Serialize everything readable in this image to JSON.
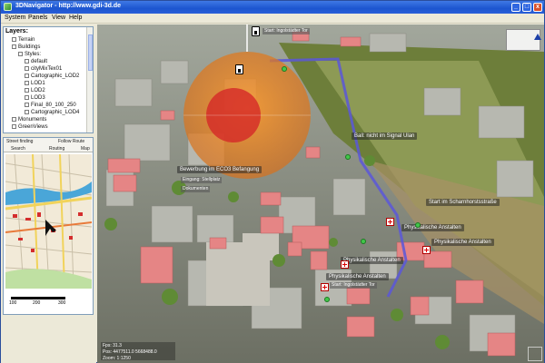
{
  "window": {
    "title": "3DNavigator - http://www.gdi-3d.de",
    "minimize": "_",
    "maximize": "□",
    "close": "x"
  },
  "menu": [
    "System",
    "Panels",
    "View",
    "Help"
  ],
  "layers": {
    "title": "Layers:",
    "items": [
      {
        "label": "Terrain",
        "indent": 1
      },
      {
        "label": "Buildings",
        "indent": 1
      },
      {
        "label": "Styles:",
        "indent": 2
      },
      {
        "label": "default",
        "indent": 3
      },
      {
        "label": "cityMixTex01",
        "indent": 3
      },
      {
        "label": "Cartographic_LOD2",
        "indent": 3
      },
      {
        "label": "LOD1",
        "indent": 3
      },
      {
        "label": "LOD2",
        "indent": 3
      },
      {
        "label": "LOD3",
        "indent": 3
      },
      {
        "label": "Final_80_100_250",
        "indent": 3
      },
      {
        "label": "Cartographic_LOD4",
        "indent": 3
      },
      {
        "label": "Monuments",
        "indent": 1
      },
      {
        "label": "GreenViews",
        "indent": 1
      }
    ]
  },
  "nav": {
    "tabs_top": [
      "Street finding",
      "Follow Route"
    ],
    "tabs": [
      "Search",
      "Routing",
      "Map"
    ],
    "scale": [
      "100",
      "200",
      "300"
    ]
  },
  "map_labels": [
    {
      "text": "Start: Ingolstädter Tor",
      "kind": "dark"
    },
    {
      "text": "Ball: nicht im Signal Ulan",
      "kind": "std"
    },
    {
      "text": "Bewerbung im ECO3 Befangung",
      "kind": "std"
    },
    {
      "text": "Eingang: Stellplatz",
      "kind": "dark"
    },
    {
      "text": "Dokumenten",
      "kind": "dark"
    },
    {
      "text": "Ball: nicht im Signal Ulan",
      "kind": "std"
    },
    {
      "text": "Start im Scharnhorstsstraße",
      "kind": "std"
    },
    {
      "text": "Physikalische Anstalten",
      "kind": "std"
    },
    {
      "text": "Physikalische Anstalten",
      "kind": "std"
    },
    {
      "text": "Physikalische Anstalten",
      "kind": "std"
    },
    {
      "text": "Physikalische Anstalten",
      "kind": "std"
    },
    {
      "text": "Start: Ingolstädter Tor",
      "kind": "dark"
    }
  ],
  "status": {
    "line1": "Fps: 31.3",
    "line2": "Pos: 4477511.0 5668488.0",
    "line3": "Zoom: 1:1250"
  },
  "colors": {
    "titlebar": "#1c55cf",
    "dome": "#e58a2a",
    "dome_core": "#d42828",
    "route": "#5a57d9",
    "building_highlight": "#e87a7a"
  }
}
